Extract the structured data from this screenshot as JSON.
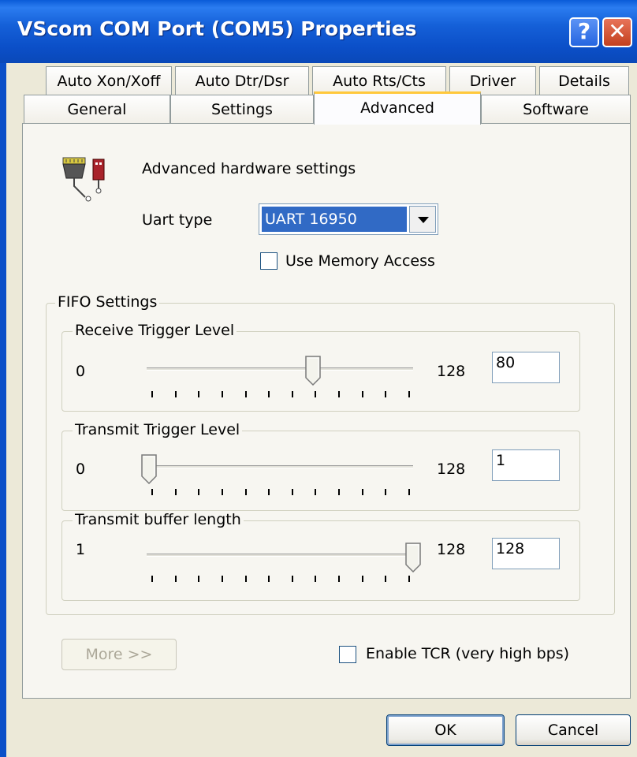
{
  "window": {
    "title": "VScom COM Port (COM5) Properties",
    "help_glyph": "?",
    "close_glyph": "✕"
  },
  "tabs_row1": [
    "Auto Xon/Xoff",
    "Auto Dtr/Dsr",
    "Auto Rts/Cts",
    "Driver",
    "Details"
  ],
  "tabs_row2": [
    "General",
    "Settings",
    "Advanced",
    "Software"
  ],
  "active_tab": "Advanced",
  "advanced": {
    "heading": "Advanced hardware settings",
    "uart_label": "Uart type",
    "uart_value": "UART 16950",
    "memory_access_label": "Use Memory Access",
    "memory_access_checked": false
  },
  "fifo": {
    "title": "FIFO Settings",
    "receive": {
      "title": "Receive Trigger Level",
      "min": "0",
      "max": "128",
      "value": "80",
      "position": 80
    },
    "transmit": {
      "title": "Transmit Trigger Level",
      "min": "0",
      "max": "128",
      "value": "1",
      "position": 1
    },
    "buffer": {
      "title": "Transmit buffer length",
      "min": "1",
      "max": "128",
      "value": "128",
      "position": 128
    }
  },
  "more_button": "More >>",
  "tcr_label": "Enable TCR (very high bps)",
  "tcr_checked": false,
  "ok_button": "OK",
  "cancel_button": "Cancel"
}
